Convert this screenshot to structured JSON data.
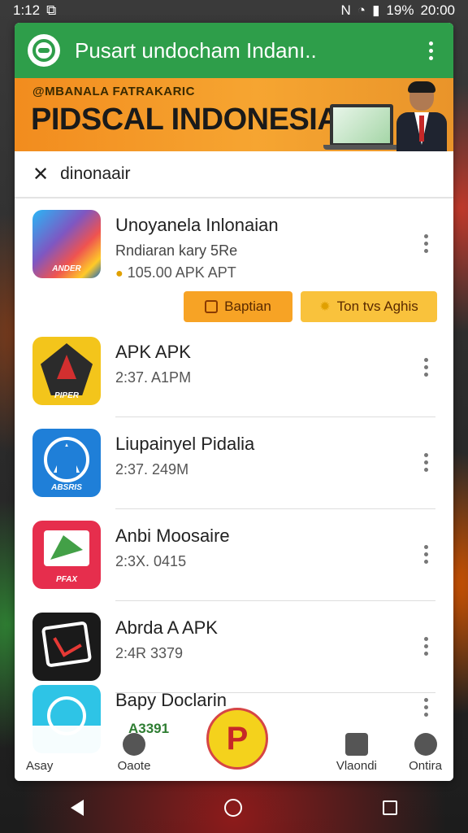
{
  "status": {
    "time": "1:12",
    "battery": "19%",
    "clock": "20:00"
  },
  "appbar": {
    "title": "Pusart undocham Indanı.."
  },
  "banner": {
    "subtitle": "@MBANALA FATRAKARIC",
    "title": "PIDSCAL INDONESIA"
  },
  "search": {
    "query": "dinonaair"
  },
  "featured": {
    "name": "Unoyanela Inlonaian",
    "subtitle": "Rndiaran kary 5Re",
    "size": "105.00 APK APT",
    "icon_label": "ANDER",
    "primary_button": "Baptian",
    "secondary_button": "Ton tvs Aghis"
  },
  "apps": [
    {
      "name": "APK APK",
      "size": "2:37. A1PM",
      "icon_label": "PIPER",
      "icon_color": "#f3c51b"
    },
    {
      "name": "Liupainyel Pidalia",
      "size": "2:37. 249M",
      "icon_label": "ABSRIS",
      "icon_color": "#1f7fd8"
    },
    {
      "name": "Anbi Moosaire",
      "size": "2:3X. 0415",
      "icon_label": "PFAX",
      "icon_color": "#e62e4d"
    },
    {
      "name": "Abrda A APK",
      "size": "2:4R 3379",
      "icon_label": "",
      "icon_color": "#1a1a1a"
    }
  ],
  "overlay": {
    "name": "Bapy Doclarin",
    "chip": "A3391"
  },
  "bottom_nav": {
    "left": "Asay",
    "center_left": "Oaote",
    "center_right": "Vlaondi",
    "right": "Ontira"
  }
}
